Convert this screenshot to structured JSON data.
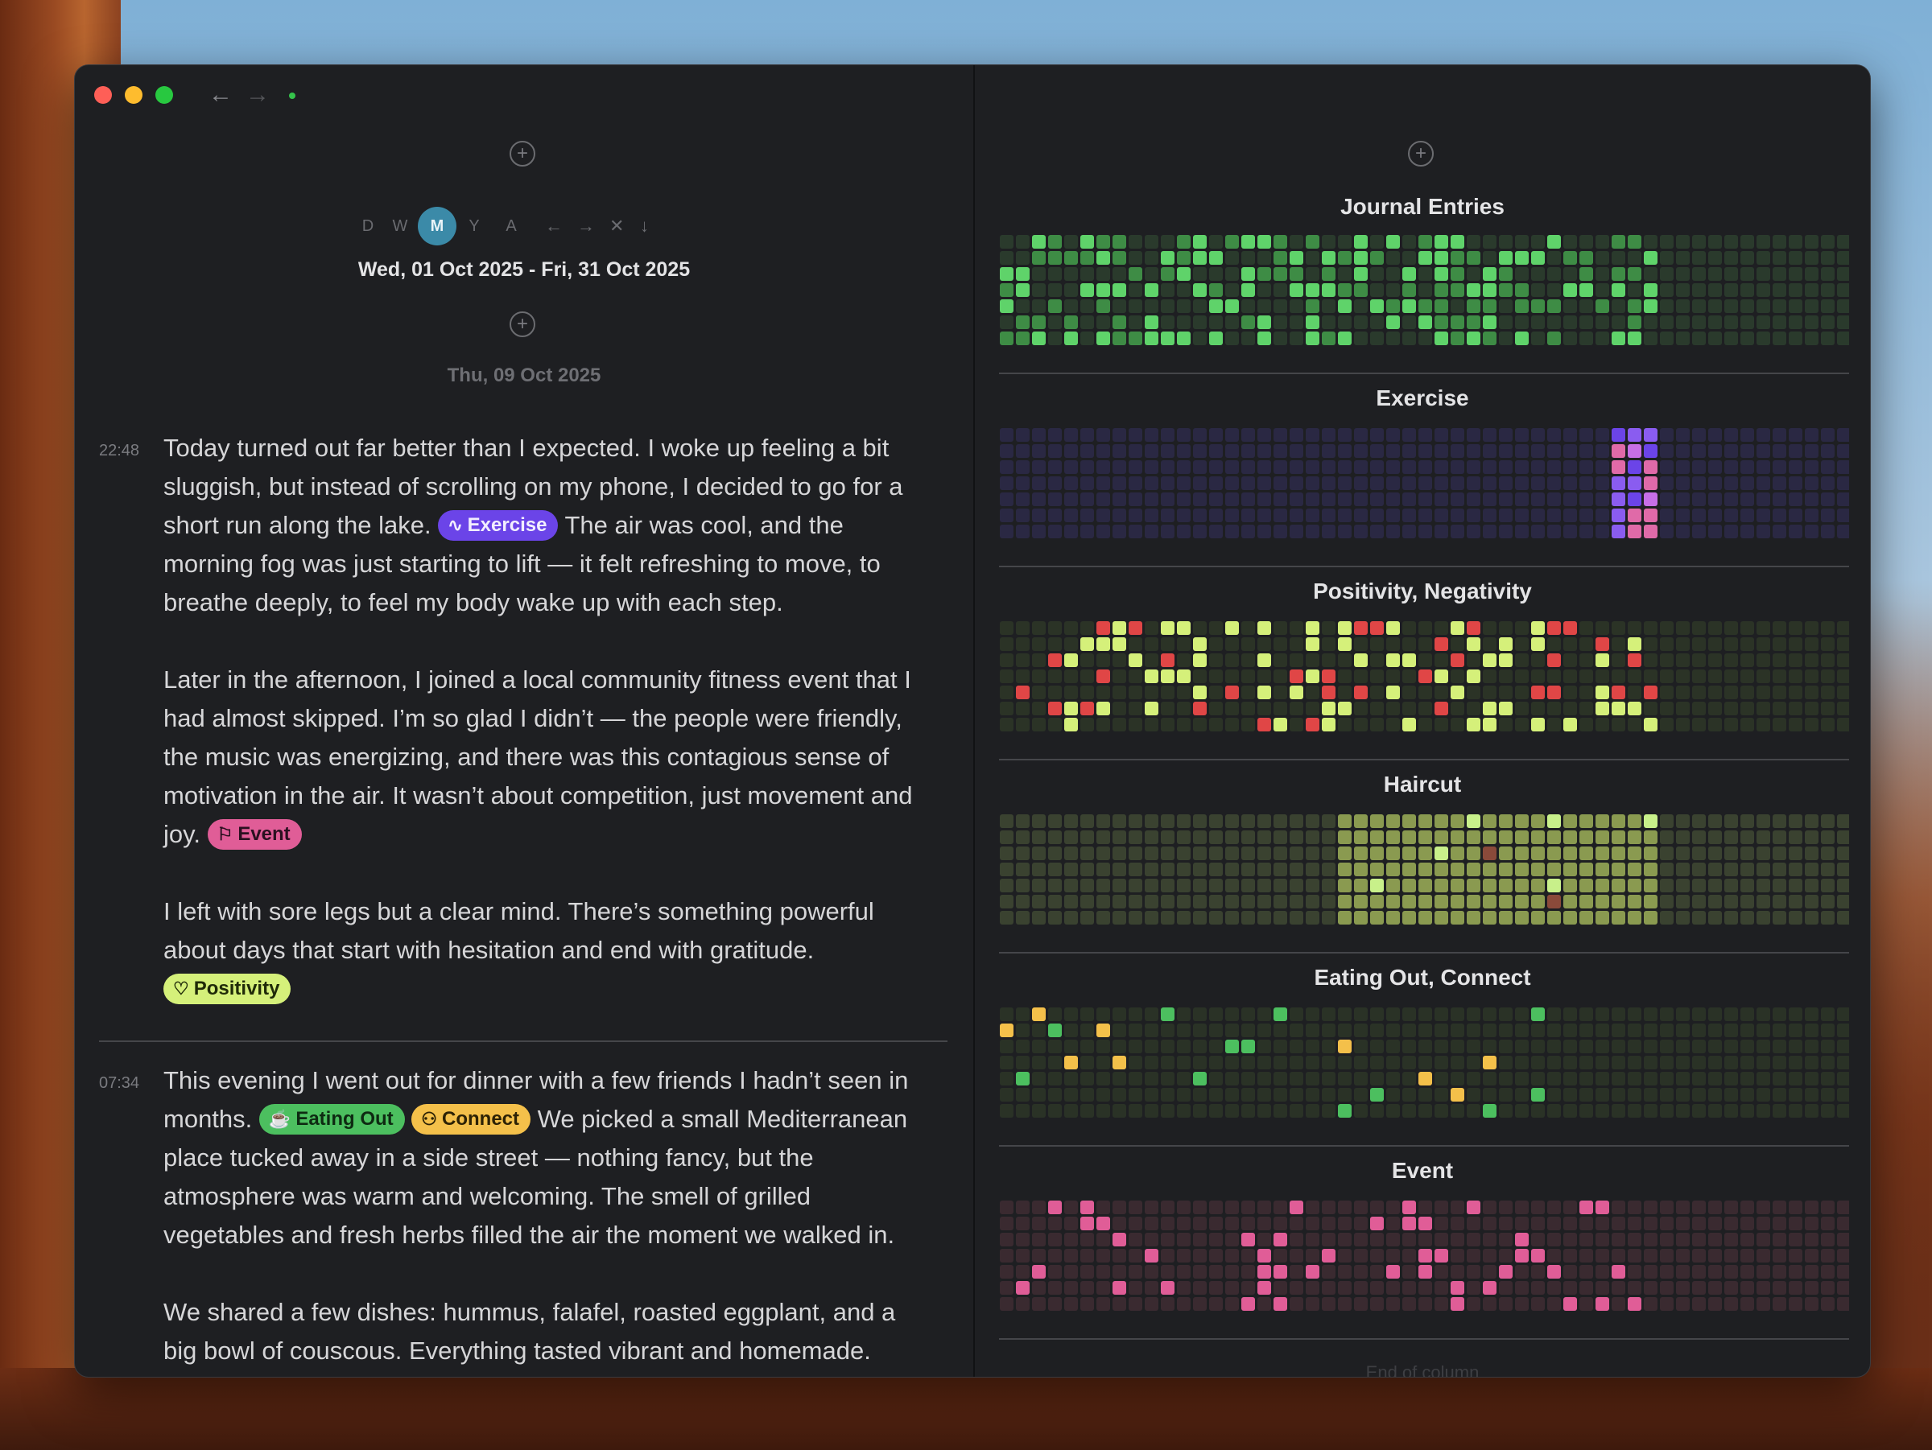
{
  "toolbar": {
    "back_icon": "arrow-left-icon",
    "forward_icon": "arrow-right-icon"
  },
  "left": {
    "scale_options": [
      "D",
      "W",
      "M",
      "Y",
      "A"
    ],
    "scale_selected": "M",
    "range_controls": [
      "←",
      "→",
      "✕",
      "↓"
    ],
    "date_range": "Wed, 01 Oct 2025 - Fri, 31 Oct 2025",
    "day_label": "Thu, 09 Oct 2025",
    "entries": [
      {
        "time": "22:48",
        "p1_a": "Today turned out far better than I expected. I woke up feeling a bit sluggish, but instead of scrolling on my phone, I decided to go for a short run along the lake.",
        "p1_b": "The air was cool, and the morning fog was just starting to lift — it felt refreshing to move, to breathe deeply, to feel my body wake up with each step.",
        "p2": "Later in the afternoon, I joined a local community fitness event that I had almost skipped. I’m so glad I didn’t — the people were friendly, the music was energizing, and there was this contagious sense of motivation in the air. It wasn’t about competition, just movement and joy.",
        "p3": "I left with sore legs but a clear mind. There’s something powerful about days that start with hesitation and end with gratitude."
      },
      {
        "time": "07:34",
        "p1_a": "This evening I went out for dinner with a few friends I hadn’t seen in months.",
        "p1_b": "We picked a small Mediterranean place tucked away in a side street — nothing fancy, but the atmosphere was warm and welcoming. The smell of grilled vegetables and fresh herbs filled the air the moment we walked in.",
        "p2": "We shared a few dishes: hummus, falafel, roasted eggplant, and a big bowl of couscous. Everything tasted vibrant and homemade."
      }
    ],
    "tags": {
      "exercise": "Exercise",
      "event": "Event",
      "positivity": "Positivity",
      "eating_out": "Eating Out",
      "connect": "Connect"
    }
  },
  "right": {
    "panels": [
      "Journal Entries",
      "Exercise",
      "Positivity, Negativity",
      "Haircut",
      "Eating Out, Connect",
      "Event"
    ],
    "end_text": "End of column"
  },
  "colors": {
    "exercise": "#6b44e8",
    "event": "#e05d97",
    "positivity": "#d5f07a",
    "negativity": "#e04646",
    "eating_out": "#4cbf5f",
    "connect": "#f4c04a",
    "haircut": "#8a9a50",
    "accent": "#3b8aa8"
  }
}
